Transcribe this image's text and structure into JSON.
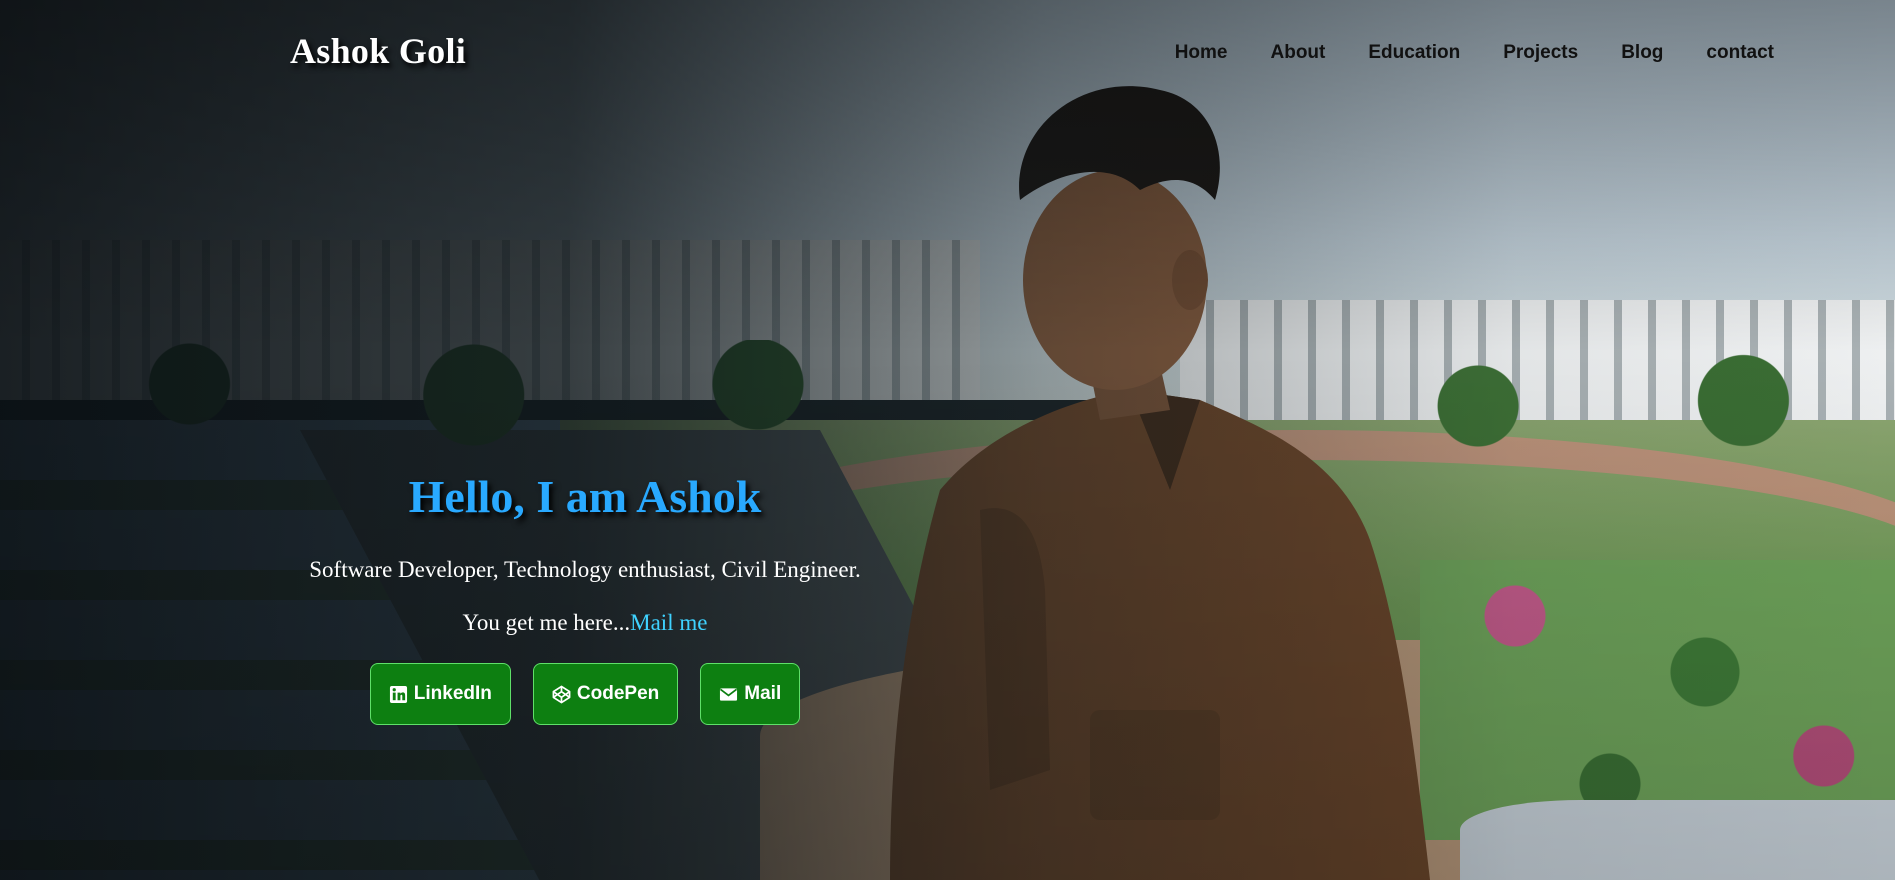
{
  "brand": {
    "name": "Ashok Goli"
  },
  "nav": {
    "items": [
      {
        "label": "Home"
      },
      {
        "label": "About"
      },
      {
        "label": "Education"
      },
      {
        "label": "Projects"
      },
      {
        "label": "Blog"
      },
      {
        "label": "contact"
      }
    ]
  },
  "hero": {
    "greeting": "Hello, I am Ashok",
    "tagline": "Software Developer, Technology enthusiast, Civil Engineer.",
    "mail_prefix": "You get me here...",
    "mail_link": "Mail me",
    "buttons": [
      {
        "label": "LinkedIn",
        "icon": "linkedin-icon"
      },
      {
        "label": "CodePen",
        "icon": "codepen-icon"
      },
      {
        "label": "Mail",
        "icon": "envelope-icon"
      }
    ]
  },
  "colors": {
    "accent_heading": "#29a9ff",
    "link": "#3fd2ff",
    "button_bg": "#0d7f11",
    "button_border": "#5fe069"
  }
}
